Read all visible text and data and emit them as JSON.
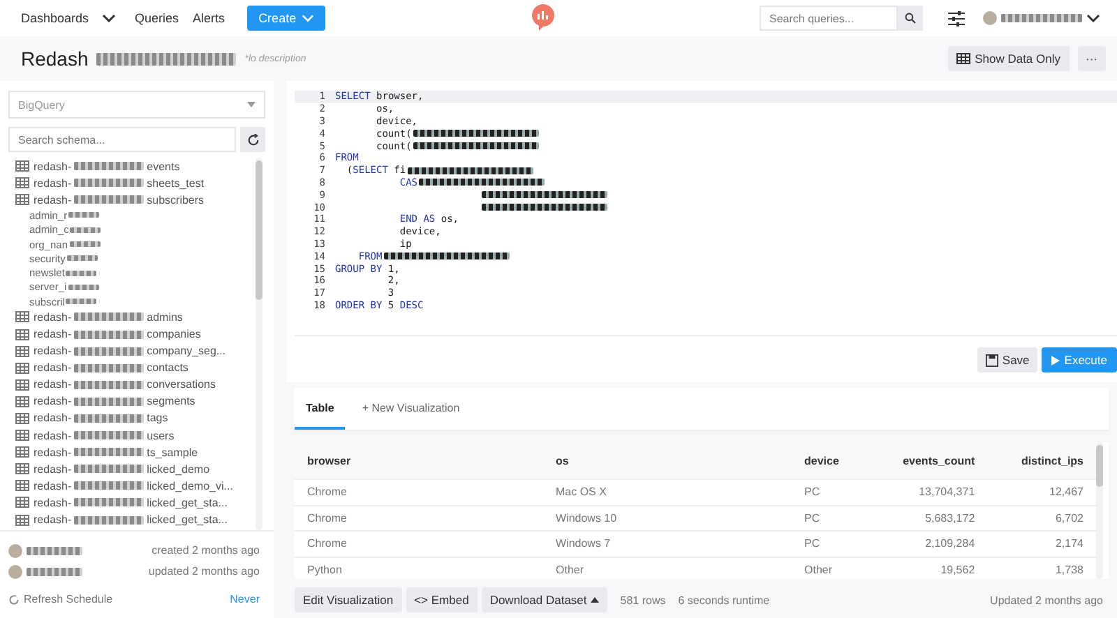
{
  "nav": {
    "items": [
      {
        "label": "Dashboards",
        "dropdown": true
      },
      {
        "label": "Queries",
        "dropdown": false
      },
      {
        "label": "Alerts",
        "dropdown": false
      }
    ],
    "create": "Create",
    "search_placeholder": "Search queries..."
  },
  "title": {
    "start": "Redash",
    "description": "*lo description",
    "show_data": "Show Data Only",
    "more": "···"
  },
  "schema": {
    "source": "BigQuery",
    "search_placeholder": "Search schema...",
    "tables": [
      {
        "start": "redash-",
        "end": "events"
      },
      {
        "start": "redash-",
        "end": "sheets_test"
      },
      {
        "start": "redash-",
        "end": "subscribers",
        "children": [
          {
            "start": "admin_r"
          },
          {
            "start": "admin_c"
          },
          {
            "start": "org_nan"
          },
          {
            "start": "security"
          },
          {
            "start": "newslet"
          },
          {
            "start": "server_i"
          },
          {
            "start": "subscril"
          }
        ]
      },
      {
        "start": "redash-",
        "end": "admins"
      },
      {
        "start": "redash-",
        "end": "companies"
      },
      {
        "start": "redash-",
        "end": "company_seg..."
      },
      {
        "start": "redash-",
        "end": "contacts"
      },
      {
        "start": "redash-",
        "end": "conversations"
      },
      {
        "start": "redash-",
        "end": "segments"
      },
      {
        "start": "redash-",
        "end": "tags"
      },
      {
        "start": "redash-",
        "end": "users"
      },
      {
        "start": "redash-",
        "end": "ts_sample"
      },
      {
        "start": "redash-",
        "end": "licked_demo"
      },
      {
        "start": "redash-",
        "end": "licked_demo_vi..."
      },
      {
        "start": "redash-",
        "end": "licked_get_sta..."
      },
      {
        "start": "redash-",
        "end": "licked_get_sta..."
      }
    ],
    "created": "created 2 months ago",
    "updated": "updated 2 months ago",
    "refresh_label": "Refresh Schedule",
    "refresh_value": "Never"
  },
  "editor": {
    "lines": [
      {
        "number": "1",
        "parts": [
          {
            "kind": "keyword",
            "text": "SELECT"
          },
          {
            "kind": "plain",
            "text": " browser,"
          }
        ]
      },
      {
        "number": "2",
        "parts": [
          {
            "kind": "plain",
            "text": "       os,"
          }
        ]
      },
      {
        "number": "3",
        "parts": [
          {
            "kind": "plain",
            "text": "       device,"
          }
        ]
      },
      {
        "number": "4",
        "parts": [
          {
            "kind": "plain",
            "text": "       count("
          },
          {
            "kind": "redacted"
          }
        ]
      },
      {
        "number": "5",
        "parts": [
          {
            "kind": "plain",
            "text": "       count("
          },
          {
            "kind": "redacted"
          }
        ]
      },
      {
        "number": "6",
        "parts": [
          {
            "kind": "keyword",
            "text": "FROM"
          }
        ]
      },
      {
        "number": "7",
        "parts": [
          {
            "kind": "plain",
            "text": "  ("
          },
          {
            "kind": "keyword",
            "text": "SELECT"
          },
          {
            "kind": "plain",
            "text": " fi"
          },
          {
            "kind": "redacted"
          }
        ]
      },
      {
        "number": "8",
        "parts": [
          {
            "kind": "keyword",
            "text": "           CAS"
          },
          {
            "kind": "redacted"
          }
        ]
      },
      {
        "number": "9",
        "parts": [
          {
            "kind": "redacted"
          }
        ]
      },
      {
        "number": "10",
        "parts": [
          {
            "kind": "redacted"
          }
        ]
      },
      {
        "number": "11",
        "parts": [
          {
            "kind": "keyword",
            "text": "           END AS"
          },
          {
            "kind": "plain",
            "text": " os,"
          }
        ]
      },
      {
        "number": "12",
        "parts": [
          {
            "kind": "plain",
            "text": "           device,"
          }
        ]
      },
      {
        "number": "13",
        "parts": [
          {
            "kind": "plain",
            "text": "           ip"
          }
        ]
      },
      {
        "number": "14",
        "parts": [
          {
            "kind": "keyword",
            "text": "    FROM"
          },
          {
            "kind": "redacted"
          }
        ]
      },
      {
        "number": "15",
        "parts": [
          {
            "kind": "keyword",
            "text": "GROUP BY"
          },
          {
            "kind": "plain",
            "text": " 1,"
          }
        ]
      },
      {
        "number": "16",
        "parts": [
          {
            "kind": "plain",
            "text": "         2,"
          }
        ]
      },
      {
        "number": "17",
        "parts": [
          {
            "kind": "plain",
            "text": "         3"
          }
        ]
      },
      {
        "number": "18",
        "parts": [
          {
            "kind": "keyword",
            "text": "ORDER BY"
          },
          {
            "kind": "plain",
            "text": " 5 "
          },
          {
            "kind": "keyword",
            "text": "DESC"
          }
        ]
      }
    ],
    "save": "Save",
    "execute": "Execute"
  },
  "results": {
    "tabs": [
      {
        "label": "Table",
        "selected": true
      },
      {
        "label": "+ New Visualization",
        "selected": false
      }
    ],
    "columns": [
      {
        "label": "browser",
        "kind": "text"
      },
      {
        "label": "os",
        "kind": "text"
      },
      {
        "label": "device",
        "kind": "text"
      },
      {
        "label": "events_count",
        "kind": "number"
      },
      {
        "label": "distinct_ips",
        "kind": "number"
      }
    ],
    "rows": [
      [
        "Chrome",
        "Mac OS X",
        "PC",
        "13,704,371",
        "12,467"
      ],
      [
        "Chrome",
        "Windows 10",
        "PC",
        "5,683,172",
        "6,702"
      ],
      [
        "Chrome",
        "Windows 7",
        "PC",
        "2,109,284",
        "2,174"
      ],
      [
        "Python",
        "Other",
        "Other",
        "19,562",
        "1,738"
      ]
    ],
    "edit": "Edit Visualization",
    "embed": "<> Embed",
    "download": "Download Dataset",
    "rows_count": "581 rows",
    "runtime": "6 seconds runtime",
    "updated": "Updated 2 months ago"
  }
}
